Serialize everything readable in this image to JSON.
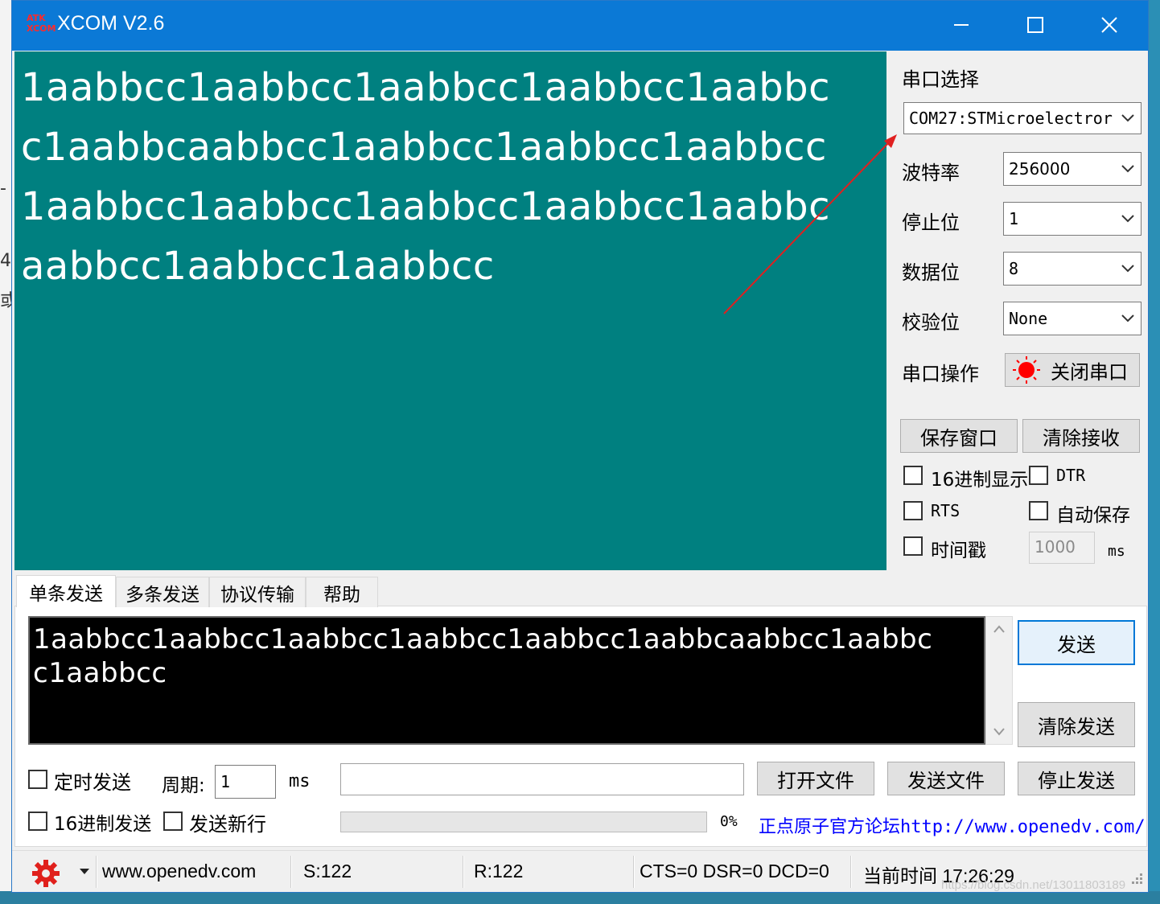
{
  "background": {
    "fragments": [
      "-",
      "4",
      "或"
    ]
  },
  "window": {
    "logo_top": "ATK",
    "logo_bottom": "XCOM",
    "title": "XCOM V2.6",
    "titlebar_color": "#0b79d6"
  },
  "receive": {
    "lines": [
      "1aabbcc1aabbcc1aabbcc1aabbcc1aabbc",
      "c1aabbcaabbcc1aabbcc1aabbcc1aabbcc",
      "1aabbcc1aabbcc1aabbcc1aabbcc1aabbc",
      "aabbcc1aabbcc1aabbcc"
    ],
    "background_color": "#008080"
  },
  "settings": {
    "port_label": "串口选择",
    "port_value": "COM27:STMicroelectror",
    "baud_label": "波特率",
    "baud_value": "256000",
    "stop_label": "停止位",
    "stop_value": "1",
    "data_label": "数据位",
    "data_value": "8",
    "parity_label": "校验位",
    "parity_value": "None",
    "op_label": "串口操作",
    "op_button": "关闭串口",
    "save_button": "保存窗口",
    "clear_recv_button": "清除接收",
    "hex_display": "16进制显示",
    "dtr": "DTR",
    "rts": "RTS",
    "auto_save": "自动保存",
    "timestamp": "时间戳",
    "timestamp_value": "1000",
    "timestamp_unit": "ms"
  },
  "tabs": [
    "单条发送",
    "多条发送",
    "协议传输",
    "帮助"
  ],
  "send": {
    "lines": [
      "1aabbcc1aabbcc1aabbcc1aabbcc1aabbcc1aabbcaabbcc1aabbc",
      "c1aabbcc"
    ],
    "send_button": "发送",
    "clear_send_button": "清除发送",
    "timed_send": "定时发送",
    "period_label": "周期:",
    "period_value": "1",
    "period_unit": "ms",
    "file_path": "",
    "open_file_button": "打开文件",
    "send_file_button": "发送文件",
    "stop_send_button": "停止发送",
    "hex_send": "16进制发送",
    "send_newline": "发送新行",
    "progress_text": "0%",
    "progress_value": 0,
    "link_text": "正点原子官方论坛http://www.openedv.com/"
  },
  "status": {
    "website": "www.openedv.com",
    "sent": "S:122",
    "received": "R:122",
    "signals": "CTS=0 DSR=0 DCD=0",
    "time": "当前时间 17:26:29"
  },
  "watermark": "https://blog.csdn.net/13011803189"
}
